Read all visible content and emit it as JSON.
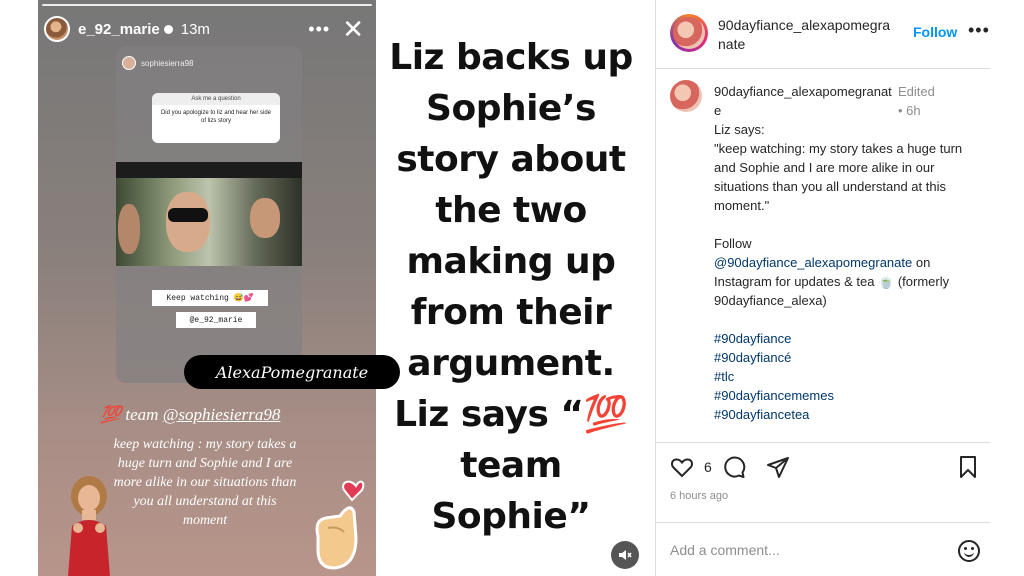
{
  "story": {
    "username": "e_92_marie",
    "time": "13m",
    "more_icon": "more-horizontal-icon",
    "close_icon": "close-icon",
    "inner": {
      "username": "sophiesierra98",
      "question_title": "Ask me a question",
      "question_text": "Did you apologize to liz and hear her side of lizs story",
      "keep_watching": "Keep watching 😅💕",
      "mention": "@e_92_marie"
    },
    "team_prefix": "💯 team ",
    "team_mention": "@sophiesierra98",
    "caption": "keep watching : my story takes a huge turn and Sophie and I are more alike in our situations than you all understand at this moment"
  },
  "watermark": "AlexaPomegranate",
  "headline": "Liz backs up Sophie’s story about the two making up from their argument. Liz says “💯 team Sophie”",
  "mute_icon": "mute-icon",
  "post": {
    "username": "90dayfiance_alexapomegranate",
    "follow_label": "Follow",
    "more_label": "•••",
    "comment": {
      "username": "90dayfiance_alexapomegranate",
      "meta": "Edited • 6h",
      "line1": "Liz says:",
      "line2": "\"keep watching: my story takes a huge turn and Sophie and I are more alike in our situations than you all understand at this moment.\"",
      "follow_word": "Follow",
      "follow_link": "@90dayfiance_alexapomegranate",
      "follow_rest": " on Instagram for updates & tea 🍵 (formerly 90dayfiance_alexa)",
      "hashtags": [
        "#90dayfiance",
        "#90dayfiancé",
        "#tlc",
        "#90dayfiancememes",
        "#90dayfiancetea"
      ]
    },
    "like_count": "6",
    "time": "6 hours ago",
    "comment_placeholder": "Add a comment..."
  }
}
